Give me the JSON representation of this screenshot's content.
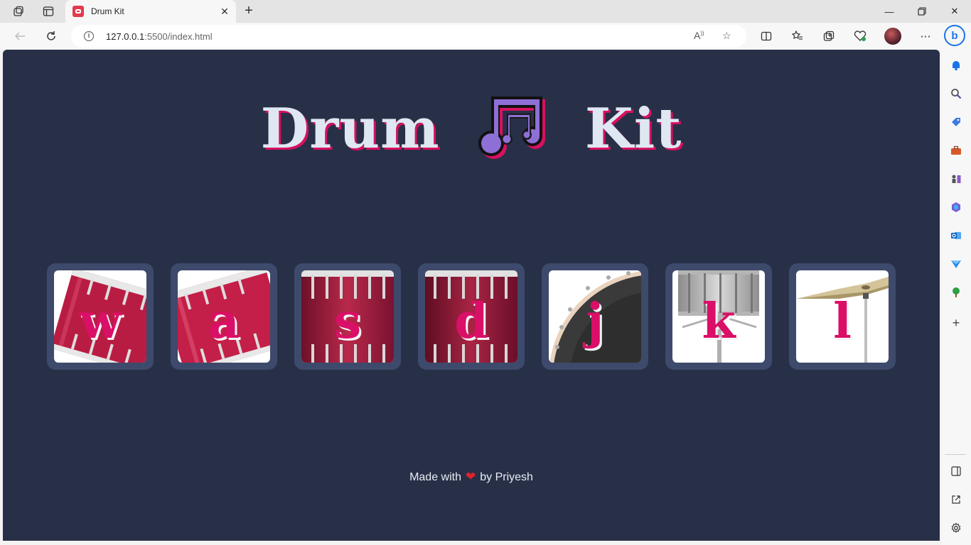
{
  "browser": {
    "tab_title": "Drum Kit",
    "url_host": "127.0.0.1",
    "url_path": ":5500/index.html",
    "accent": "#1a73e8"
  },
  "page": {
    "title_left": "Drum",
    "title_right": "Kit",
    "keys": [
      {
        "letter": "w",
        "image": "tom-drum-tilted"
      },
      {
        "letter": "a",
        "image": "tom-drum-tilted"
      },
      {
        "letter": "s",
        "image": "snare-drum"
      },
      {
        "letter": "d",
        "image": "snare-drum"
      },
      {
        "letter": "j",
        "image": "bass-drum"
      },
      {
        "letter": "k",
        "image": "silver-drum-stand"
      },
      {
        "letter": "l",
        "image": "crash-cymbal"
      }
    ],
    "footer_prefix": "Made with",
    "footer_suffix": "by Priyesh",
    "colors": {
      "background": "#283048",
      "key_frame": "#3e4a6b",
      "letter": "#da0f68",
      "title": "#dfe7f2",
      "title_shadow": "#d6115f"
    }
  }
}
